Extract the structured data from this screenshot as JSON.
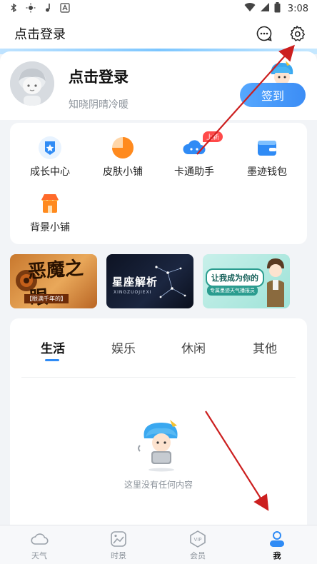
{
  "status_bar": {
    "time": "3:08",
    "left_icons": [
      "bluetooth-icon",
      "brightness-icon",
      "music-icon",
      "text-icon"
    ],
    "right_icons": [
      "wifi-icon",
      "signal-icon",
      "battery-icon"
    ]
  },
  "header": {
    "title": "点击登录",
    "icons": [
      "message-icon",
      "settings-icon"
    ]
  },
  "profile": {
    "name": "点击登录",
    "subtitle": "知晓阴晴冷暖",
    "signin_label": "签到"
  },
  "features": {
    "items": [
      {
        "label": "成长中心",
        "icon": "medal-icon"
      },
      {
        "label": "皮肤小铺",
        "icon": "pie-icon"
      },
      {
        "label": "卡通助手",
        "icon": "cartoon-cloud-icon",
        "badge": "上新"
      },
      {
        "label": "墨迹钱包",
        "icon": "wallet-icon"
      },
      {
        "label": "背景小铺",
        "icon": "shop-icon"
      }
    ]
  },
  "banners": [
    {
      "text": "恶魔之眼",
      "caption": "【眼满千年的】"
    },
    {
      "text": "星座解析",
      "caption": "XINGZUOJIEXI"
    },
    {
      "text": "让我成为你的",
      "caption": "专属墨迹天气播报员"
    }
  ],
  "tabs": {
    "items": [
      "生活",
      "娱乐",
      "休闲",
      "其他"
    ],
    "active_index": 0
  },
  "empty_state": {
    "text": "这里没有任何内容"
  },
  "bottom_nav": {
    "items": [
      {
        "label": "天气",
        "icon": "cloud-icon"
      },
      {
        "label": "时景",
        "icon": "picture-icon"
      },
      {
        "label": "会员",
        "icon": "vip-icon"
      },
      {
        "label": "我",
        "icon": "person-icon"
      }
    ],
    "active_index": 3
  },
  "colors": {
    "accent": "#3c8df5",
    "annotation": "#cc1f1f"
  }
}
